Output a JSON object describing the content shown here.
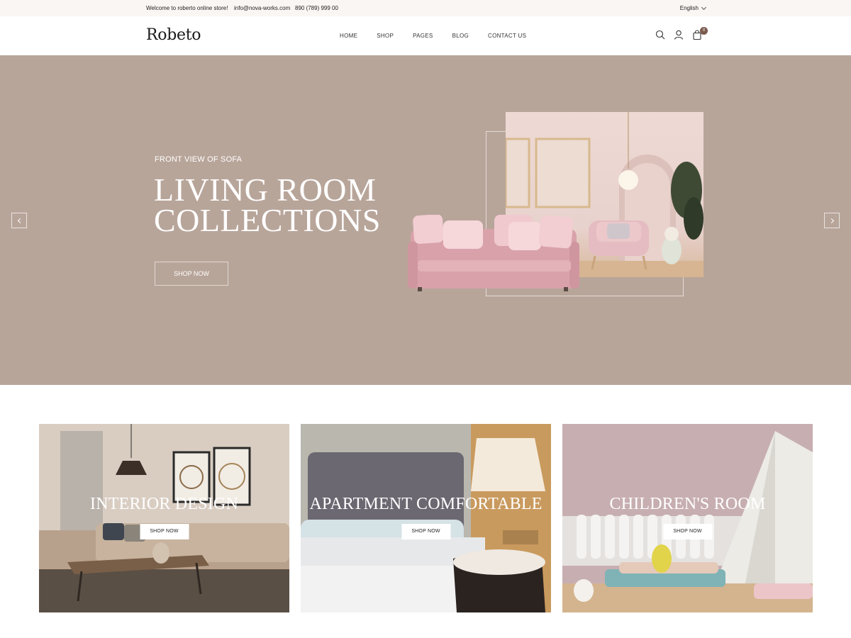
{
  "topbar": {
    "welcome": "Welcome to roberto online store!",
    "email": "info@nova-works.com",
    "phone": "890 (789) 999 00",
    "language": "English"
  },
  "header": {
    "logo": "Robeto",
    "nav": [
      "HOME",
      "SHOP",
      "PAGES",
      "BLOG",
      "CONTACT US"
    ],
    "icons": [
      "search-icon",
      "user-icon",
      "cart-icon"
    ],
    "cart_count": "0"
  },
  "hero": {
    "subtitle": "FRONT VIEW OF SOFA",
    "title_line1": "LIVING ROOM",
    "title_line2": "COLLECTIONS",
    "button": "SHOP NOW",
    "background": "#b8a59a"
  },
  "categories": [
    {
      "title": "INTERIOR DESIGN",
      "button": "SHOP NOW"
    },
    {
      "title": "APARTMENT COMFORTABLE",
      "button": "SHOP NOW"
    },
    {
      "title": "CHILDREN'S ROOM",
      "button": "SHOP NOW"
    }
  ],
  "colors": {
    "accent": "#7a5a4e",
    "topbar_bg": "#faf6f3"
  }
}
